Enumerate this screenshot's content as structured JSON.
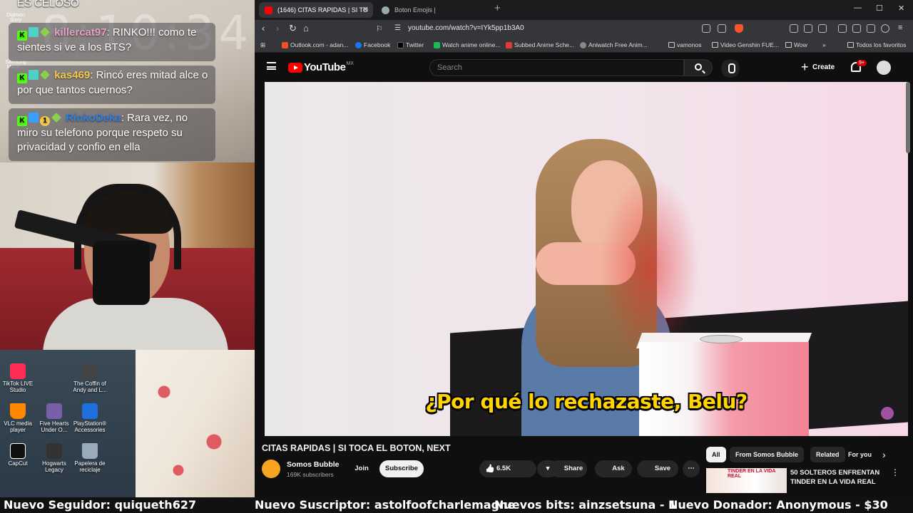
{
  "overlay": {
    "title": "ES CELOSO",
    "clock": "8:10:34",
    "chat": [
      {
        "user": "killercat97",
        "user_color": "#e8a0c8",
        "message": ": RINKO!!! como te sientes si ve a los BTS?"
      },
      {
        "user": "kas469",
        "user_color": "#f2c94c",
        "message": ": Rincó eres mitad alce o por que tantos cuernos?"
      },
      {
        "user": "RinkoDeka",
        "user_color": "#2f7ee0",
        "message": ": Rara vez, no miro su telefono porque respeto su privacidad y confio en ella"
      }
    ],
    "desktop_icons": [
      {
        "label": "TikTok LIVE Studio",
        "color": "#ff2d55"
      },
      {
        "label": "The Coffin of Andy and L...",
        "color": "#444"
      },
      {
        "label": "VLC media player",
        "color": "#ff8800"
      },
      {
        "label": "Five Hearts Under O...",
        "color": "#7a5ea8"
      },
      {
        "label": "PlayStation® Accessories",
        "color": "#1f6fe0"
      },
      {
        "label": "CapCut",
        "color": "#111"
      },
      {
        "label": "Hogwarts Legacy",
        "color": "#333"
      },
      {
        "label": "Papelera de reciclaje",
        "color": "#9ab"
      }
    ],
    "top_left_icons": [
      {
        "label": "Digimon Story"
      },
      {
        "label": "Samsung Magic..."
      }
    ]
  },
  "browser": {
    "tabs": [
      {
        "label": "(1646) CITAS RAPIDAS | SI TO",
        "active": true,
        "favicon_color": "#ff0000"
      },
      {
        "label": "Boton Emojis |",
        "active": false,
        "favicon_color": "#9aa"
      }
    ],
    "url": "youtube.com/watch?v=IYk5pp1b3A0",
    "bookmarks": [
      {
        "label": "Outlook.com - adan...",
        "color": "#f25022"
      },
      {
        "label": "Facebook",
        "color": "#1877f2"
      },
      {
        "label": "Twitter",
        "color": "#000"
      },
      {
        "label": "Watch anime online...",
        "color": "#1db954"
      },
      {
        "label": "Subbed Anime Sche...",
        "color": "#e53935"
      },
      {
        "label": "Aniwatch Free Anim...",
        "color": "#888"
      },
      {
        "label": "vamonos",
        "folder": true
      },
      {
        "label": "Video Genshin FUE...",
        "folder": true
      },
      {
        "label": "Wow",
        "folder": true
      },
      {
        "label": "Todos los favoritos",
        "folder": true
      }
    ]
  },
  "youtube": {
    "logo_text": "YouTube",
    "region": "MX",
    "search_placeholder": "Search",
    "create_label": "Create",
    "notifications": "9+",
    "video": {
      "subtitle": "¿Por qué lo rechazaste, Belu?",
      "title": "CITAS RAPIDAS | SI TOCA EL BOTON, NEXT"
    },
    "channel": {
      "name": "Somos Bubble",
      "subscribers": "169K subscribers",
      "join_label": "Join",
      "subscribe_label": "Subscribe"
    },
    "actions": {
      "likes": "6.5K",
      "share": "Share",
      "ask": "Ask",
      "save": "Save"
    },
    "chips": [
      "All",
      "From Somos Bubble",
      "Related",
      "For you"
    ],
    "recommended": {
      "thumb_text": "TINDER EN LA VIDA REAL",
      "title": "50 SOLTEROS ENFRENTAN TINDER EN LA VIDA REAL"
    }
  },
  "ticker": [
    "Nuevo Seguidor: quiqueth627",
    "Nuevo Suscriptor: astolfoofcharlemagne",
    "Nuevos bits: ainzsetsuna - 1",
    "Nuevo Donador: Anonymous - $30"
  ]
}
